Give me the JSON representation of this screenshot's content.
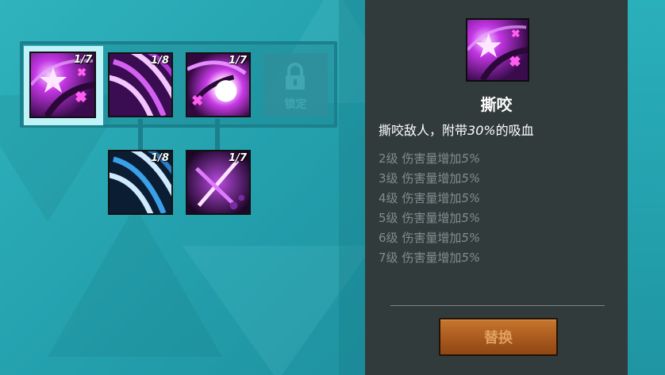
{
  "skill_tree": {
    "row1": [
      {
        "name": "撕咬",
        "level": "1/7",
        "selected": true
      },
      {
        "name": "",
        "level": "1/8",
        "selected": false
      },
      {
        "name": "",
        "level": "1/7",
        "selected": false
      }
    ],
    "locked_slot": {
      "label": "锁定"
    },
    "row2": [
      {
        "level": "1/8"
      },
      {
        "level": "1/7"
      }
    ]
  },
  "detail": {
    "title": "撕咬",
    "description_prefix": "撕咬敌人，附带",
    "description_value": "30%",
    "description_suffix": "的吸血",
    "level_bonuses": [
      {
        "level": "2级",
        "text": "伤害量增加",
        "value": "5%"
      },
      {
        "level": "3级",
        "text": "伤害量增加",
        "value": "5%"
      },
      {
        "level": "4级",
        "text": "伤害量增加",
        "value": "5%"
      },
      {
        "level": "5级",
        "text": "伤害量增加",
        "value": "5%"
      },
      {
        "level": "6级",
        "text": "伤害量增加",
        "value": "5%"
      },
      {
        "level": "7级",
        "text": "伤害量增加",
        "value": "5%"
      }
    ],
    "replace_button": "替换"
  },
  "colors": {
    "panel_bg": "#323b3c",
    "button": "#b0621f",
    "accent_cyan": "#2fb3bd",
    "skill_purple": "#c02adf",
    "skill_blue": "#3aa0e8"
  }
}
